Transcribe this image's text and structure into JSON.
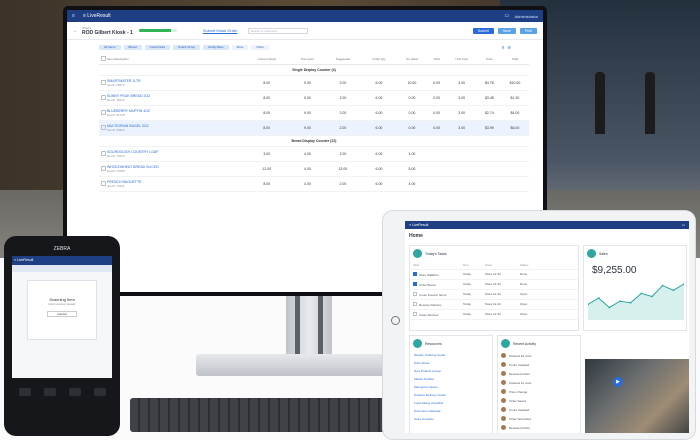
{
  "app": {
    "brand": "≡ LiveResult",
    "user": "Administrator"
  },
  "order": {
    "breadcrumb": "Orders",
    "title": "ROD Gilbert Kiosk - 1",
    "progress": 0.85
  },
  "toolbar": {
    "link": "Submit Kiosk Order",
    "search_placeholder": "Search or scan item",
    "btn1": "Submit",
    "btn2": "Save",
    "btn3": "Print"
  },
  "chips": [
    "All Items",
    "Bread",
    "Cold Drinks",
    "Snack Chips",
    "Candy Bars",
    "More",
    "Other"
  ],
  "grid": {
    "columns": [
      "Item Description",
      "Current Stock",
      "Par Level",
      "Suggested",
      "Order Qty",
      "On Hand",
      "Sold",
      "Unit Cost",
      "Price",
      "Total"
    ],
    "groups": [
      {
        "name": "Single Display Counter (4)",
        "rows": [
          {
            "name": "SMARTWATER 1LTR",
            "sub": "Item#: 26574",
            "v": [
              "8.00",
              "9.00",
              "2.00",
              "6.00",
              "10.00",
              "0.00",
              "3.00",
              "$4.78",
              "$10.00"
            ]
          },
          {
            "name": "SUNNY PEAK BREAD 2OZ",
            "sub": "Item#: 48210",
            "v": [
              "8.00",
              "9.00",
              "2.00",
              "6.00",
              "0.00",
              "0.00",
              "3.00",
              "$3.48",
              "$1.30"
            ]
          },
          {
            "name": "BLUEBERRY MUFFIN 4OZ",
            "sub": "Item#: 51738",
            "v": [
              "8.00",
              "9.00",
              "2.00",
              "6.00",
              "0.00",
              "0.00",
              "3.00",
              "$2.74",
              "$4.00"
            ]
          },
          {
            "name": "MULTIGRAIN BAGEL 3OZ",
            "sub": "Item#: 62904",
            "v": [
              "8.00",
              "9.00",
              "2.00",
              "6.00",
              "0.00",
              "0.00",
              "3.00",
              "$3.99",
              "$6.00"
            ]
          }
        ]
      },
      {
        "name": "Bread Display Counter (22)",
        "rows": [
          {
            "name": "SOURDOUGH COUNTRY LOAF",
            "sub": "Item#: 70215",
            "v": [
              "3.00",
              "4.00",
              "2.00",
              "6.00",
              "1.00",
              "",
              "",
              "",
              ""
            ]
          },
          {
            "name": "WHOLEWHEAT BREAD SLICED",
            "sub": "Item#: 70388",
            "v": [
              "12.00",
              "4.00",
              "13.00",
              "6.00",
              "5.00",
              "",
              "",
              "",
              ""
            ]
          },
          {
            "name": "FRENCH BAGUETTE",
            "sub": "Item#: 70441",
            "v": [
              "8.00",
              "4.00",
              "2.00",
              "6.00",
              "4.00",
              "",
              "",
              "",
              ""
            ]
          }
        ]
      }
    ]
  },
  "phone": {
    "brand": "ZEBRA",
    "bar": "≡ LiveResult",
    "card_title": "Scanning Item",
    "card_sub": "Hold scanner steady",
    "card_btn": "Cancel"
  },
  "tablet": {
    "bar": "≡ LiveResult",
    "title": "Home",
    "tasks_title": "Today's Tasks",
    "task_cols": [
      "Task",
      "Due",
      "Store",
      "Status"
    ],
    "tasks": [
      {
        "done": true,
        "t": "Store Walkthru",
        "d": "Today",
        "s": "Store 12-34",
        "st": "Done"
      },
      {
        "done": true,
        "t": "Order Bread",
        "d": "Today",
        "s": "Store 12-34",
        "st": "Done"
      },
      {
        "done": false,
        "t": "Count Freezer Items",
        "d": "Today",
        "s": "Store 12-34",
        "st": "Open"
      },
      {
        "done": false,
        "t": "Receive Delivery",
        "d": "Today",
        "s": "Store 12-34",
        "st": "Open"
      },
      {
        "done": false,
        "t": "Clean Shelves",
        "d": "Today",
        "s": "Store 12-34",
        "st": "Open"
      }
    ],
    "sales_title": "Sales",
    "sales_value": "$9,255.00",
    "sales_trend": [
      20,
      28,
      16,
      24,
      22,
      34,
      30,
      44,
      38,
      46
    ],
    "resources_title": "Resources",
    "resources": [
      "Weekly Ordering Guide",
      "Price Sheet",
      "New Product Lineup",
      "Market Profiles",
      "Planogram Specs",
      "Produce Delivery Guide",
      "Food Safety Checklist",
      "Promotion Calendar",
      "Store Contacts"
    ],
    "activity_title": "Recent Activity",
    "activity": [
      "Ordered 24 units",
      "Count Updated",
      "Received Order",
      "Ordered 12 units",
      "Price Change",
      "Order Saved",
      "Count Updated",
      "Order Submitted",
      "Received Order",
      "Count Updated"
    ],
    "colors": {
      "accent": "#2a6bd8",
      "teal": "#2fa6a0",
      "nav": "#1f3f84"
    }
  }
}
